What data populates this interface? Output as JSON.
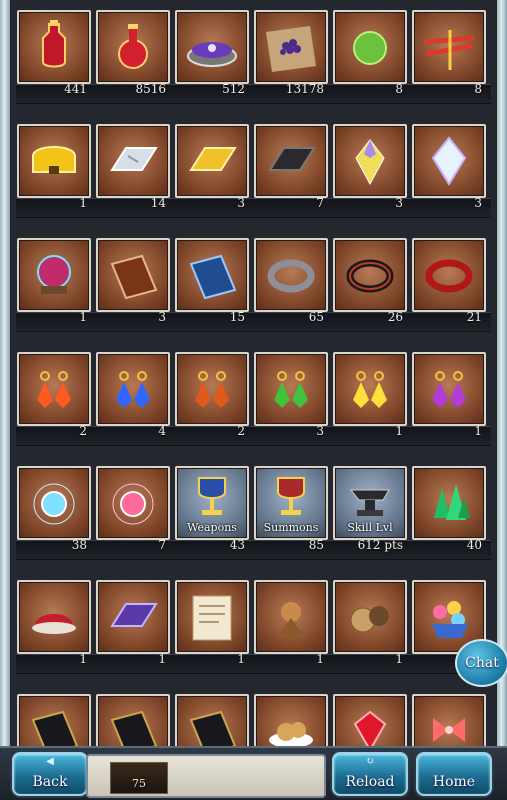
{
  "inventory": {
    "rows": [
      {
        "items": [
          {
            "icon": "red-elixir-icon",
            "count": "441"
          },
          {
            "icon": "red-potion-icon",
            "count": "8516"
          },
          {
            "icon": "treasure-box-icon",
            "count": "512"
          },
          {
            "icon": "purple-berries-icon",
            "count": "13178"
          },
          {
            "icon": "green-orb-icon",
            "count": "8"
          },
          {
            "icon": "red-dragonfly-icon",
            "count": "8"
          }
        ]
      },
      {
        "items": [
          {
            "icon": "gold-coin-icon",
            "count": "1"
          },
          {
            "icon": "silver-ingot-icon",
            "count": "14"
          },
          {
            "icon": "gold-ingot-icon",
            "count": "3"
          },
          {
            "icon": "dark-ingot-icon",
            "count": "7"
          },
          {
            "icon": "amber-crystal-icon",
            "count": "3"
          },
          {
            "icon": "rainbow-crystal-icon",
            "count": "3"
          }
        ]
      },
      {
        "items": [
          {
            "icon": "crystal-ball-icon",
            "count": "1"
          },
          {
            "icon": "brown-book-icon",
            "count": "3"
          },
          {
            "icon": "blue-book-icon",
            "count": "15"
          },
          {
            "icon": "silver-ring-icon",
            "count": "65"
          },
          {
            "icon": "black-ring-icon",
            "count": "26"
          },
          {
            "icon": "red-ring-icon",
            "count": "21"
          }
        ]
      },
      {
        "items": [
          {
            "icon": "fire-earrings-icon",
            "count": "2"
          },
          {
            "icon": "water-earrings-icon",
            "count": "4"
          },
          {
            "icon": "earth-earrings-icon",
            "count": "2"
          },
          {
            "icon": "wind-earrings-icon",
            "count": "3"
          },
          {
            "icon": "light-earrings-icon",
            "count": "1"
          },
          {
            "icon": "dark-earrings-icon",
            "count": "1"
          }
        ]
      },
      {
        "items": [
          {
            "icon": "blue-orb-icon",
            "count": "38"
          },
          {
            "icon": "pink-orb-icon",
            "count": "7"
          },
          {
            "icon": "chalice-weapons-icon",
            "count": "43",
            "label": "Weapons",
            "silver": true
          },
          {
            "icon": "chalice-summons-icon",
            "count": "85",
            "label": "Summons",
            "silver": true
          },
          {
            "icon": "anvil-icon",
            "count": "612  pts",
            "label": "Skill Lvl",
            "silver": true
          },
          {
            "icon": "green-crystals-icon",
            "count": "40"
          }
        ]
      },
      {
        "items": [
          {
            "icon": "red-pudding-icon",
            "count": "1"
          },
          {
            "icon": "purple-ingot-icon",
            "count": "1"
          },
          {
            "icon": "letter-scroll-icon",
            "count": "1"
          },
          {
            "icon": "beast-figure-icon",
            "count": "1"
          },
          {
            "icon": "cookies-icon",
            "count": "1"
          },
          {
            "icon": "flower-basket-icon",
            "count": ""
          }
        ]
      },
      {
        "items": [
          {
            "icon": "black-book-icon",
            "count": ""
          },
          {
            "icon": "black-book-icon",
            "count": ""
          },
          {
            "icon": "black-book-icon",
            "count": ""
          },
          {
            "icon": "cookie-plate-icon",
            "count": ""
          },
          {
            "icon": "red-gem-icon",
            "count": ""
          },
          {
            "icon": "ribbon-icon",
            "count": ""
          }
        ]
      }
    ]
  },
  "nav": {
    "back_label": "Back",
    "reload_label": "Reload",
    "home_label": "Home",
    "status_value": "75"
  },
  "chat": {
    "label": "Chat"
  },
  "colors": {
    "accent": "#2a8fbb",
    "tile": "#8a4a2a",
    "frame": "#d8d4ce"
  }
}
